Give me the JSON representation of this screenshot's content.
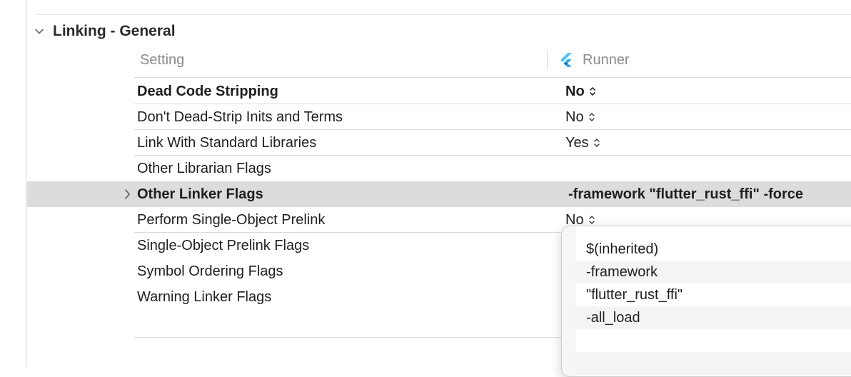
{
  "section": {
    "title": "Linking - General"
  },
  "columns": {
    "setting": "Setting",
    "target": "Runner"
  },
  "rows": [
    {
      "name": "Dead Code Stripping",
      "value": "No"
    },
    {
      "name": "Don't Dead-Strip Inits and Terms",
      "value": "No"
    },
    {
      "name": "Link With Standard Libraries",
      "value": "Yes"
    },
    {
      "name": "Other Librarian Flags",
      "value": ""
    },
    {
      "name": "Other Linker Flags",
      "value": "-framework \"flutter_rust_ffi\" -force"
    },
    {
      "name": "Perform Single-Object Prelink",
      "value": "No"
    },
    {
      "name": "Single-Object Prelink Flags",
      "value": ""
    },
    {
      "name": "Symbol Ordering Flags",
      "value": ""
    },
    {
      "name": "Warning Linker Flags",
      "value": ""
    }
  ],
  "popover": {
    "items": [
      "$(inherited)",
      "-framework",
      "\"flutter_rust_ffi\"",
      "-all_load"
    ]
  },
  "colors": {
    "selection": "#dcdcdc",
    "flutter_blue": "#54c5f8",
    "flutter_dark": "#01579b"
  }
}
